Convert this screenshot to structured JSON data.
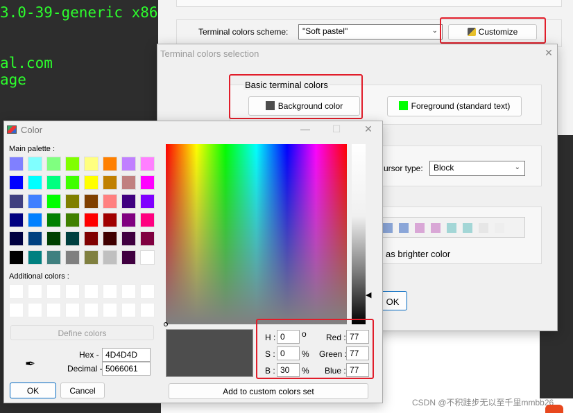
{
  "terminal": {
    "lines": [
      "3.0-39-generic x86",
      "al.com",
      "age"
    ]
  },
  "settings": {
    "scheme_label": "Terminal colors scheme:",
    "scheme_value": "\"Soft pastel\"",
    "customize_label": "Customize",
    "cursor_label": "ursor type:",
    "cursor_value": "Block",
    "brighter_label": "as brighter color",
    "ok_partial": "OK"
  },
  "palette_preview": [
    "#8ba6d8",
    "#8ba6d8",
    "#d9a7d6",
    "#d9a7d6",
    "#a3d6d6",
    "#a3d6d6",
    "#e6e6e6",
    "#eeeeee"
  ],
  "terminal_colors_dialog": {
    "title": "Terminal colors selection",
    "group_title": "Basic terminal colors",
    "bg_button": "Background color",
    "fg_button": "Foreground (standard text)",
    "bg_color": "#4d4d4d",
    "fg_color": "#00ff00"
  },
  "color_dialog": {
    "title": "Color",
    "main_palette_label": "Main palette :",
    "additional_label": "Additional colors :",
    "define_button": "Define colors",
    "hex_label": "Hex -",
    "hex_value": "4D4D4D",
    "decimal_label": "Decimal -",
    "decimal_value": "5066061",
    "ok_button": "OK",
    "cancel_button": "Cancel",
    "add_button": "Add to custom colors set",
    "h_label": "H :",
    "h_value": "0",
    "h_unit": "o",
    "s_label": "S :",
    "s_value": "0",
    "s_unit": "%",
    "b_label": "B :",
    "b_value": "30",
    "b_unit": "%",
    "red_label": "Red :",
    "red_value": "77",
    "green_label": "Green :",
    "green_value": "77",
    "blue_label": "Blue :",
    "blue_value": "77",
    "preview_color": "#4d4d4d",
    "palette": [
      [
        "#8080ff",
        "#80ffff",
        "#80ff80",
        "#80ff00",
        "#ffff80",
        "#ff8000",
        "#c080ff",
        "#ff80ff"
      ],
      [
        "#0000ff",
        "#00ffff",
        "#00ff80",
        "#40ff00",
        "#ffff00",
        "#c08000",
        "#c08080",
        "#ff00ff"
      ],
      [
        "#404080",
        "#4080ff",
        "#00ff00",
        "#808000",
        "#804000",
        "#ff8080",
        "#400080",
        "#8000ff"
      ],
      [
        "#000080",
        "#0080ff",
        "#008000",
        "#408000",
        "#ff0000",
        "#a00000",
        "#800080",
        "#ff0080"
      ],
      [
        "#000040",
        "#004080",
        "#004000",
        "#004040",
        "#800000",
        "#400000",
        "#400040",
        "#800040"
      ],
      [
        "#000000",
        "#008080",
        "#408080",
        "#808080",
        "#808040",
        "#c0c0c0",
        "#400040",
        "#ffffff"
      ]
    ]
  },
  "watermark": "CSDN @不积跬步无以至千里mmbb26"
}
